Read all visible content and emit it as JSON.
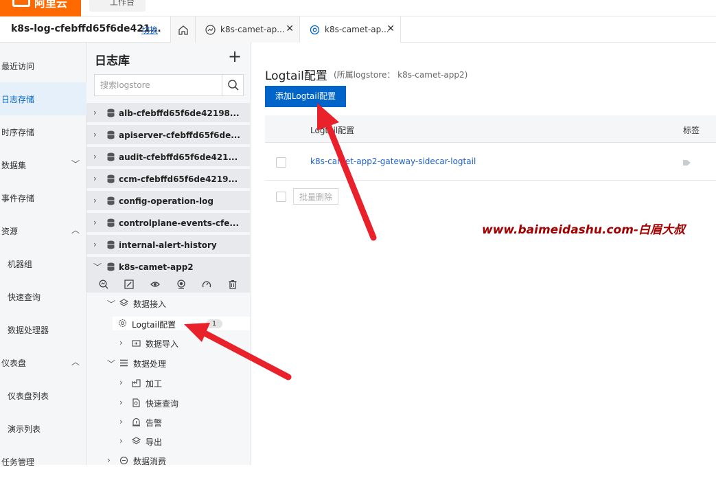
{
  "topbar": {
    "logo_text": "阿里云",
    "workbench": "工作台"
  },
  "tabrow": {
    "project": "k8s-log-cfebffd65f6de421...",
    "switch": "切换",
    "tabs": [
      {
        "label": "k8s-camet-ap...",
        "icon": "chart-icon"
      },
      {
        "label": "k8s-camet-ap...",
        "icon": "gear-icon"
      }
    ]
  },
  "leftnav": {
    "items": [
      {
        "label": "最近访问"
      },
      {
        "label": "日志存储"
      },
      {
        "label": "时序存储"
      },
      {
        "label": "数据集"
      },
      {
        "label": "事件存储"
      },
      {
        "label": "资源"
      },
      {
        "label": "机器组"
      },
      {
        "label": "快速查询"
      },
      {
        "label": "数据处理器"
      },
      {
        "label": "仪表盘"
      },
      {
        "label": "仪表盘列表"
      },
      {
        "label": "演示列表"
      },
      {
        "label": "任务管理"
      }
    ]
  },
  "mid": {
    "title": "日志库",
    "plus": "+",
    "search_placeholder": "搜索logstore",
    "stores": [
      {
        "name": "alb-cfebffd65f6de42198..."
      },
      {
        "name": "apiserver-cfebffd65f6de..."
      },
      {
        "name": "audit-cfebffd65f6de421..."
      },
      {
        "name": "ccm-cfebffd65f6de4219..."
      },
      {
        "name": "config-operation-log"
      },
      {
        "name": "controlplane-events-cfe..."
      },
      {
        "name": "internal-alert-history"
      },
      {
        "name": "k8s-camet-app2"
      }
    ],
    "tree": {
      "data_ingest": "数据接入",
      "logtail": "Logtail配置",
      "logtail_count": "1",
      "data_import": "数据导入",
      "data_process": "数据处理",
      "process": "加工",
      "quick_query": "快速查询",
      "alert": "告警",
      "export": "导出",
      "consume": "数据消费"
    }
  },
  "content": {
    "title": "Logtail配置",
    "subtitle": "(所属logstore： k8s-camet-app2)",
    "add_button": "添加Logtail配置",
    "col_name": "Logtail配置",
    "col_tag": "标签",
    "row_link": "k8s-camet-app2-gateway-sidecar-logtail",
    "batch_delete": "批量删除"
  },
  "watermark": "www.baimeidashu.com-白眉大叔",
  "colors": {
    "primary": "#0064c8",
    "arrow": "#e8212a",
    "watermark": "#a30000"
  }
}
